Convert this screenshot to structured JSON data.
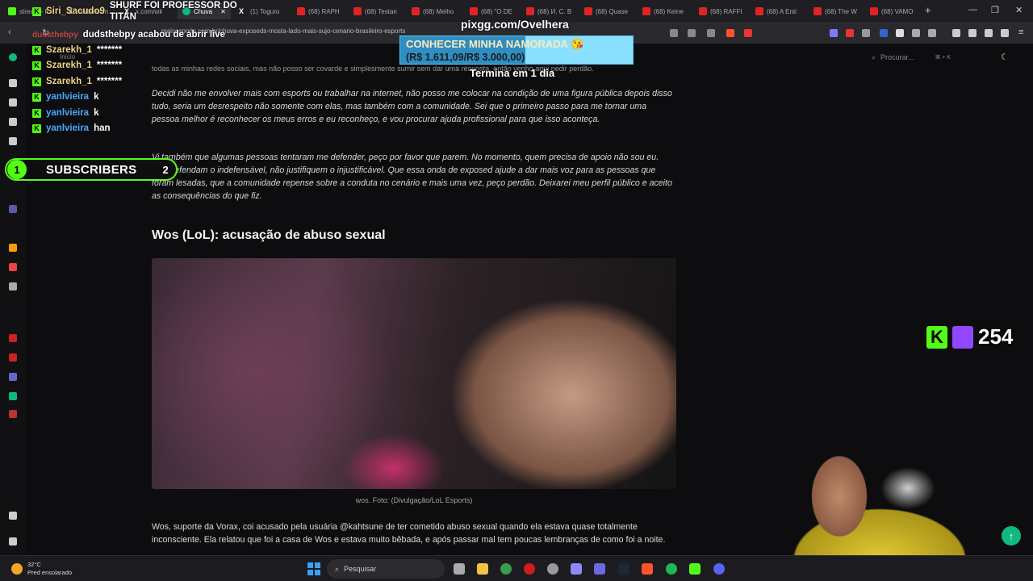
{
  "tabs": [
    {
      "label": "stream - K",
      "active": false
    },
    {
      "label": "isabella m",
      "active": false
    },
    {
      "label": "x.com/wk",
      "active": false
    },
    {
      "label": "Chuva",
      "active": true
    },
    {
      "label": "(1) Toguro",
      "active": false
    },
    {
      "label": "(68) RAPH",
      "active": false
    },
    {
      "label": "(68) Testan",
      "active": false
    },
    {
      "label": "(68) Melho",
      "active": false
    },
    {
      "label": "(68) \"O DE",
      "active": false
    },
    {
      "label": "(68) И. С. В",
      "active": false
    },
    {
      "label": "(68) Quase",
      "active": false
    },
    {
      "label": "(68) Keine",
      "active": false
    },
    {
      "label": "(68) RAFFI",
      "active": false
    },
    {
      "label": "(68) A Enti",
      "active": false
    },
    {
      "label": "(68) The W",
      "active": false
    },
    {
      "label": "(68) VAMO",
      "active": false
    }
  ],
  "browser": {
    "new_tab": "+",
    "url": "maisesports.com.br/chuva-exposeds-mosta-lado-mais-sujo-cenario-brasileiro-esports"
  },
  "site": {
    "search_placeholder": "Procurar...",
    "search_shortcut": "⌘ + K",
    "sidebar_label": "Início"
  },
  "article": {
    "partial_top": "todas as minhas redes sociais, mas não posso ser covarde e simplesmente sumir sem dar uma resposta, então venho aqui pedir perdão.",
    "paragraph_1": "Decidi não me envolver mais com esports ou trabalhar na internet, não posso me colocar na condição de uma figura pública depois disso tudo, seria um desrespeito não somente com elas, mas também com a comunidade. Sei que o primeiro passo para me tornar uma pessoa melhor é reconhecer os meus erros e eu reconheço, e vou procurar ajuda profissional para que isso aconteça.",
    "paragraph_2": "Vi também que algumas pessoas tentaram me defender, peço por favor que parem. No momento, quem precisa de apoio não sou eu. Não defendam o indefensável, não justifiquem o injustificável. Que essa onda de exposed ajude a dar mais voz para as pessoas que foram lesadas, que a comunidade repense sobre a conduta no cenário e mais uma vez, peço perdão. Deixarei meu perfil público e aceito as consequências do que fiz.",
    "heading": "Wos (LoL): acusação de abuso sexual",
    "caption": "wos. Foto: (Divulgação/LoL Esports)",
    "body": "Wos, suporte da Vorax, coi acusado pela usuária @kahtsune de ter cometido abuso sexual quando ela estava quase totalmente inconsciente. Ela relatou que foi a casa de Wos e estava muito bêbada, e após passar mal tem poucas lembranças de como foi a noite."
  },
  "overlay": {
    "chat": [
      {
        "user": "Siri_Sacudo9",
        "message": "SHURF FOI PROFESSOR DO TITAN",
        "color": "#f0d58a"
      },
      {
        "user": "dudsthebpy",
        "message": "dudsthebpy acabou de abrir live",
        "color": "#ff4a4a"
      },
      {
        "user": "Szarekh_1",
        "message": "*******",
        "color": "#f0d58a"
      },
      {
        "user": "Szarekh_1",
        "message": "*******",
        "color": "#f0d58a"
      },
      {
        "user": "Szarekh_1",
        "message": "*******",
        "color": "#f0d58a"
      },
      {
        "user": "yanlvieira",
        "message": "k",
        "color": "#4aa8ff"
      },
      {
        "user": "yanlvieira",
        "message": "k",
        "color": "#4aa8ff"
      },
      {
        "user": "yanlvieira",
        "message": "han",
        "color": "#4aa8ff"
      }
    ],
    "subscribers": {
      "label": "SUBSCRIBERS",
      "left_number": "1",
      "right_number": "2"
    },
    "pix": "pixgg.com/Ovelhera",
    "goal": {
      "title": "CONHECER MINHA NAMORADA 😘",
      "amount": "(R$ 1.611,09/R$ 3.000,00)",
      "progress": 0.537,
      "ends": "Termina em 1 dia"
    },
    "viewers": "254"
  },
  "taskbar": {
    "temperature": "32°C",
    "weather": "Pred ensolarado",
    "search": "Pesquisar"
  },
  "colors": {
    "kick_green": "#53fc18",
    "twitch_purple": "#9146ff",
    "accent_teal": "#10b981"
  }
}
